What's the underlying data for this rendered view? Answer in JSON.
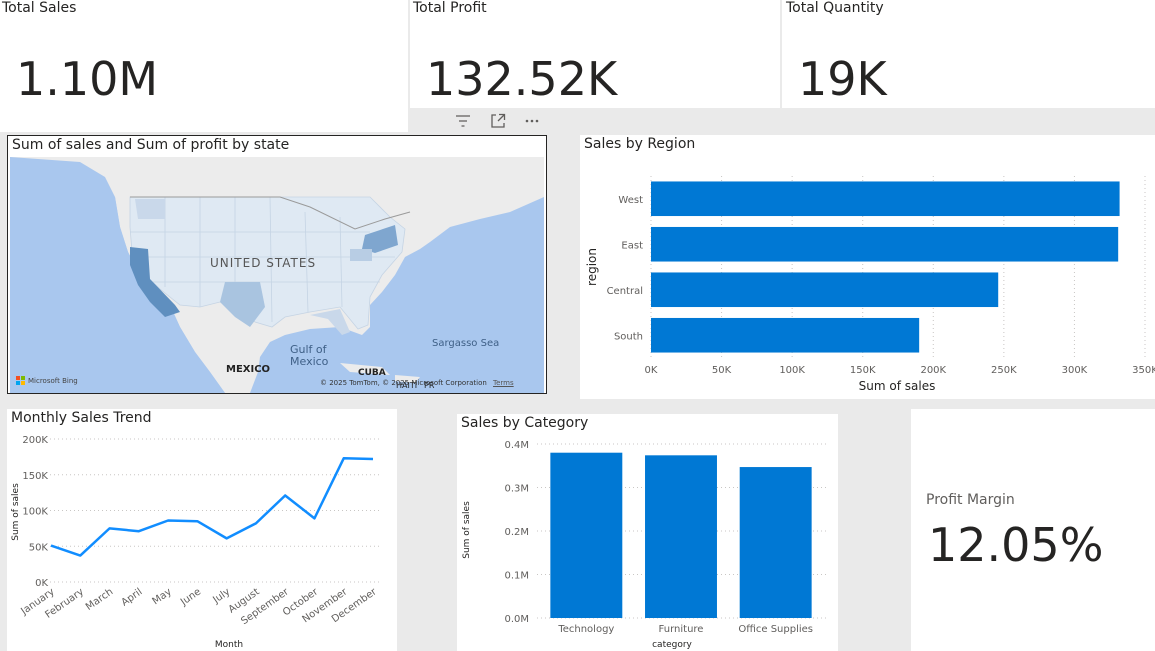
{
  "kpis": [
    {
      "title": "Total Sales",
      "value": "1.10M"
    },
    {
      "title": "Total Profit",
      "value": "132.52K"
    },
    {
      "title": "Total Quantity",
      "value": "19K"
    }
  ],
  "visual_header_icons": [
    "filter-icon",
    "focus-mode-icon",
    "more-options-icon"
  ],
  "map": {
    "title": "Sum of sales and Sum of profit by state",
    "labels": {
      "country": "UNITED STATES",
      "gulf_line1": "Gulf of",
      "gulf_line2": "Mexico",
      "mexico": "MEXICO",
      "sargasso": "Sargasso Sea",
      "cuba": "CUBA",
      "haiti": "HAITI",
      "pr": "PR"
    },
    "footer": {
      "bing": "Microsoft Bing",
      "copyright": "© 2025 TomTom, © 2025 Microsoft Corporation",
      "terms": "Terms"
    },
    "colors": {
      "ocean": "#a9c7ee",
      "land": "#ececec",
      "state_light": "#dfe9f3",
      "state_mid": "#a9c4e0",
      "state_dark": "#5f8fbf"
    }
  },
  "region_chart": {
    "title": "Sales by Region",
    "xlabel": "Sum of sales",
    "ylabel": "region",
    "ticks": [
      "0K",
      "50K",
      "100K",
      "150K",
      "200K",
      "250K",
      "300K",
      "350K"
    ],
    "color": "#0078d4",
    "chart_data": {
      "type": "bar",
      "orientation": "horizontal",
      "categories": [
        "West",
        "East",
        "Central",
        "South"
      ],
      "values": [
        332000,
        331000,
        246000,
        190000
      ],
      "xlim": [
        0,
        350000
      ]
    }
  },
  "monthly_chart": {
    "title": "Monthly Sales Trend",
    "xlabel": "Month",
    "ylabel": "Sum of sales",
    "yticks": [
      "0K",
      "50K",
      "100K",
      "150K",
      "200K"
    ],
    "color": "#118dff",
    "chart_data": {
      "type": "line",
      "x": [
        "January",
        "February",
        "March",
        "April",
        "May",
        "June",
        "July",
        "August",
        "September",
        "October",
        "November",
        "December"
      ],
      "values": [
        51000,
        37000,
        75000,
        71000,
        86000,
        85000,
        61000,
        82000,
        121000,
        89000,
        173000,
        172000
      ],
      "ylim": [
        0,
        200000
      ]
    }
  },
  "category_chart": {
    "title": "Sales by Category",
    "xlabel": "category",
    "ylabel": "Sum of sales",
    "yticks": [
      "0.0M",
      "0.1M",
      "0.2M",
      "0.3M",
      "0.4M"
    ],
    "color": "#0078d4",
    "chart_data": {
      "type": "bar",
      "categories": [
        "Technology",
        "Furniture",
        "Office Supplies"
      ],
      "values": [
        380000,
        374000,
        347000
      ],
      "ylim": [
        0,
        400000
      ]
    }
  },
  "profit_margin": {
    "title": "Profit Margin",
    "value": "12.05%"
  }
}
